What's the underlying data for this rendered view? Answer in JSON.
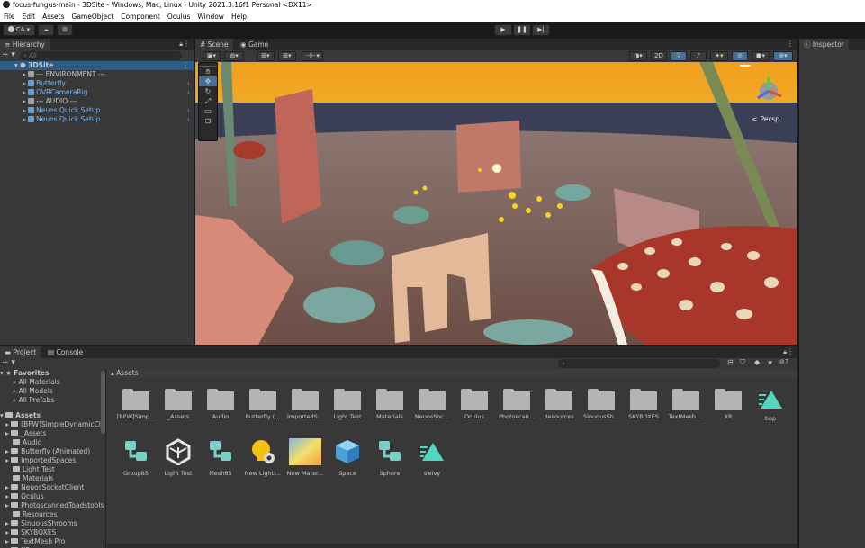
{
  "window": {
    "title": "focus-fungus-main - 3DSite - Windows, Mac, Linux - Unity 2021.3.16f1 Personal <DX11>"
  },
  "menu": [
    "File",
    "Edit",
    "Assets",
    "GameObject",
    "Component",
    "Oculus",
    "Window",
    "Help"
  ],
  "toolbar": {
    "account": "CA ▾",
    "cloud_icon": "cloud-icon",
    "collab_icon": "collab-icon",
    "play_icon": "play-icon",
    "pause_icon": "pause-icon",
    "step_icon": "step-icon"
  },
  "hierarchy": {
    "tab_label": "Hierarchy",
    "search_placeholder": "All",
    "scene_name": "3DSite",
    "items": [
      {
        "label": "--- ENVIRONMENT ---",
        "icon": "gameobject-icon",
        "prefab": false
      },
      {
        "label": "Butterfly",
        "icon": "prefab-icon",
        "prefab": true
      },
      {
        "label": "OVRCameraRig",
        "icon": "prefab-icon",
        "prefab": true
      },
      {
        "label": "--- AUDIO ---",
        "icon": "gameobject-icon",
        "prefab": false
      },
      {
        "label": "Neuos Quick Setup",
        "icon": "prefab-icon",
        "prefab": true
      },
      {
        "label": "Neuos Quick Setup",
        "icon": "prefab-icon",
        "prefab": true
      }
    ]
  },
  "scene": {
    "tabs": [
      {
        "label": "Scene"
      },
      {
        "label": "Game"
      }
    ],
    "toolbar_2d_label": "2D",
    "gizmo_label": "< Persp"
  },
  "inspector": {
    "tab_label": "Inspector"
  },
  "project": {
    "tabs": [
      {
        "label": "Project"
      },
      {
        "label": "Console"
      }
    ],
    "breadcrumb": "Assets",
    "hidden_count": "7",
    "favorites": {
      "label": "Favorites",
      "items": [
        "All Materials",
        "All Models",
        "All Prefabs"
      ]
    },
    "tree": {
      "root_label": "Assets",
      "items": [
        "[BFW]SimpleDynamicClou",
        "_Assets",
        "Audio",
        "Butterfly (Animated)",
        "ImportedSpaces",
        "Light Test",
        "Materials",
        "NeuosSocketClient",
        "Oculus",
        "PhotoscannedToadstools",
        "Resources",
        "SinuousShrooms",
        "SKYBOXES",
        "TextMesh Pro",
        "XR"
      ]
    },
    "assets_row1": [
      {
        "label": "[BFW]Simp..."
      },
      {
        "label": "_Assets"
      },
      {
        "label": "Audio"
      },
      {
        "label": "Butterfly (..."
      },
      {
        "label": "ImportedS..."
      },
      {
        "label": "Light Test"
      },
      {
        "label": "Materials"
      },
      {
        "label": "NeuosSoc..."
      },
      {
        "label": "Oculus"
      },
      {
        "label": "Photoscan..."
      },
      {
        "label": "Resources"
      },
      {
        "label": "SinuousSh..."
      },
      {
        "label": "SKYBOXES"
      },
      {
        "label": "TextMesh ..."
      },
      {
        "label": "XR"
      },
      {
        "label": "bop",
        "kind": "shader-icon"
      }
    ],
    "assets_row2": [
      {
        "label": "Group85",
        "kind": "prefab-group-icon"
      },
      {
        "label": "Light Test",
        "kind": "unity-scene-icon"
      },
      {
        "label": "Mesh85",
        "kind": "prefab-group-icon"
      },
      {
        "label": "New Lighti...",
        "kind": "lighting-settings-icon"
      },
      {
        "label": "New Mater...",
        "kind": "material-icon"
      },
      {
        "label": "Space",
        "kind": "cube-prefab-icon"
      },
      {
        "label": "Sphere",
        "kind": "prefab-group-icon"
      },
      {
        "label": "swivy",
        "kind": "shader-icon"
      }
    ]
  },
  "colors": {
    "panel_bg": "#383838",
    "tab_bg": "#282828",
    "prefab_blue": "#5aa0e0",
    "selection": "#2c5d87",
    "sky_top": "#f2a21a",
    "mushroom_red": "#a8362a"
  }
}
